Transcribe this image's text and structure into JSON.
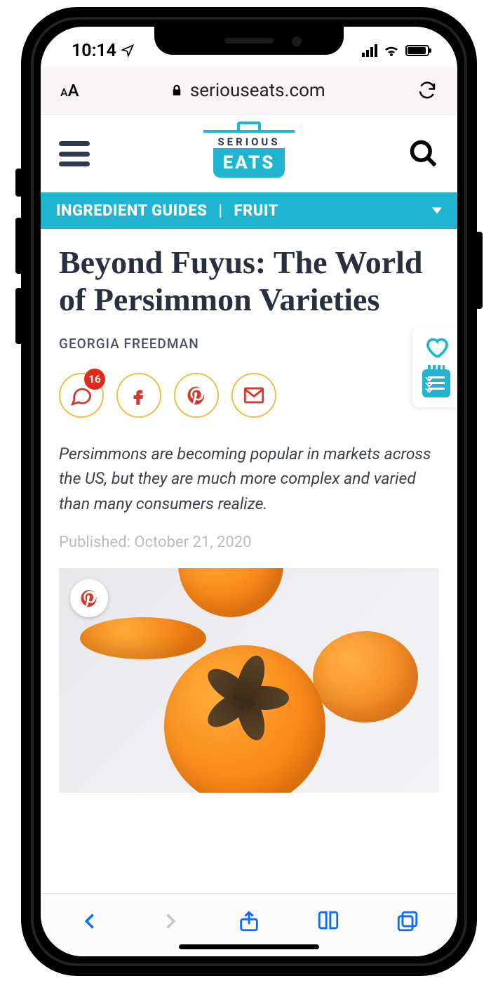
{
  "status": {
    "time": "10:14"
  },
  "browser": {
    "domain": "seriouseats.com"
  },
  "site": {
    "logo_top": "SERIOUS",
    "logo_bottom": "EATS"
  },
  "breadcrumb": {
    "parent": "INGREDIENT GUIDES",
    "child": "FRUIT"
  },
  "article": {
    "title": "Beyond Fuyus: The World of Persimmon Varieties",
    "author": "GEORGIA FREEDMAN",
    "comment_count": "16",
    "dek": "Persimmons are becoming popular in markets across the US, but they are much more complex and varied than many consumers realize.",
    "published": "Published: October 21, 2020"
  }
}
